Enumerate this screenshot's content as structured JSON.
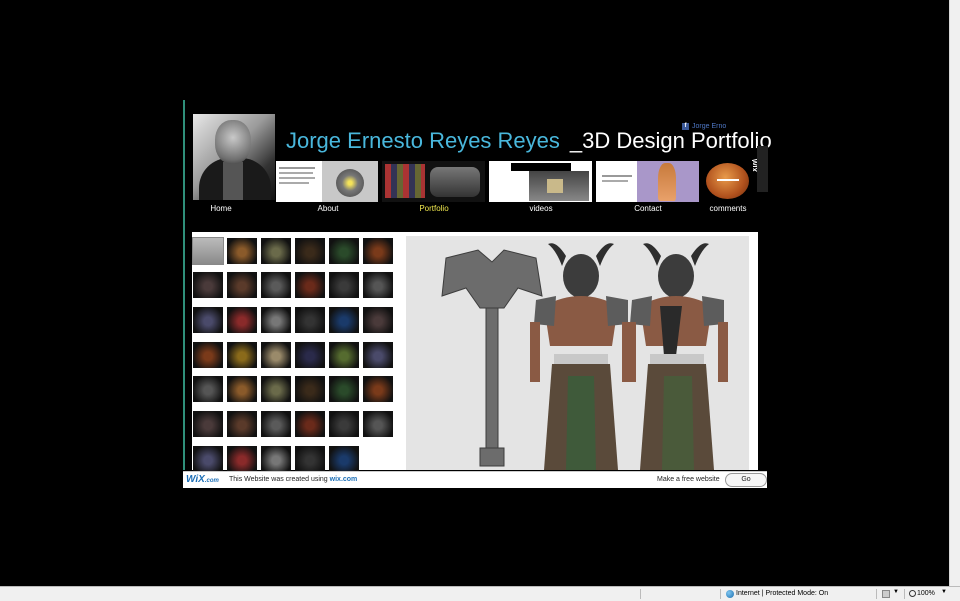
{
  "site": {
    "name": "Jorge Ernesto Reyes Reyes",
    "subtitle": "_3D Design Portfolio",
    "facebook_label": "Jorge Erno",
    "wix_badge": "WIX"
  },
  "nav": [
    {
      "label": "Home"
    },
    {
      "label": "About"
    },
    {
      "label": "Portfolio",
      "active": true
    },
    {
      "label": "videos"
    },
    {
      "label": "Contact"
    },
    {
      "label": "comments"
    }
  ],
  "wix_bar": {
    "logo": "WiX",
    "logo_suffix": ".com",
    "message": "This Website was created using",
    "link": "wix.com",
    "make": "Make a free website",
    "go": "Go"
  },
  "status_bar": {
    "zone": "Internet | Protected Mode: On",
    "zoom": "100%"
  },
  "colors": {
    "title_accent": "#49b7dc",
    "active_nav": "#f0e84e",
    "wix_blue": "#1c6fb7"
  }
}
